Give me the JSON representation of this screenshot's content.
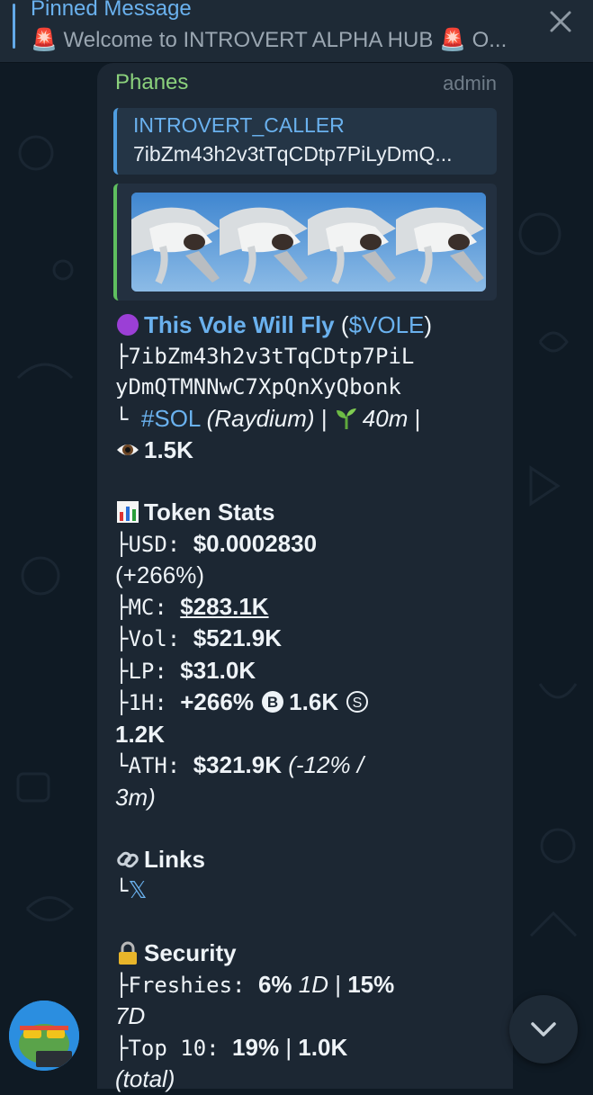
{
  "pinned": {
    "title": "Pinned Message",
    "text": "🚨 Welcome to INTROVERT ALPHA HUB 🚨 O..."
  },
  "message": {
    "sender": "Phanes",
    "role": "admin",
    "reply": {
      "name": "INTROVERT_CALLER",
      "text": "7ibZm43h2v3tTqCDtp7PiLyDmQ..."
    },
    "token_name": "This Vole Will Fly",
    "ticker_open": "(",
    "ticker": "$VOLE",
    "ticker_close": ")",
    "address_prefix": "├",
    "address_line1": "7ibZm43h2v3tTqCDtp7PiL",
    "address_line2": "yDmQTMNNwC7XpQnXyQbonk",
    "chain_prefix": "└ ",
    "chain_tag": "#SOL",
    "chain_dex": "(Raydium)",
    "sep": " | ",
    "age": "40m",
    "sep_end": " |",
    "views": "1.5K",
    "stats_title": "Token Stats",
    "stats": {
      "usd_label": "├USD:   ",
      "usd_value": "$0.0002830",
      "usd_change": "(+266%)",
      "mc_label": "├MC:    ",
      "mc_value": "$283.1K",
      "vol_label": "├Vol:   ",
      "vol_value": "$521.9K",
      "lp_label": "├LP:    ",
      "lp_value": "$31.0K",
      "h1_label": "├1H:    ",
      "h1_change": "+266%",
      "h1_buys": "1.6K",
      "h1_sells": "1.2K",
      "ath_label": "└ATH:   ",
      "ath_value": "$321.9K",
      "ath_change": "(-12% /",
      "ath_time": "3m)"
    },
    "links_title": "Links",
    "links_prefix": "└",
    "links_x": "𝕏",
    "security_title": "Security",
    "security": {
      "freshies_label": "├Freshies: ",
      "freshies_1d": "6%",
      "freshies_1d_unit": "1D",
      "freshies_7d": "15%",
      "freshies_7d_unit": "7D",
      "top10_label": "├Top 10:    ",
      "top10_pct": "19%",
      "top10_amount": "1.0K",
      "top10_note": "(total)"
    }
  },
  "colors": {
    "accent_blue": "#6ab1ee",
    "sender_green": "#8bd17c",
    "bubble": "#1c2733",
    "background": "#0f1a24"
  },
  "icons": {
    "pinned_close": "close-icon",
    "scroll_down": "chevron-down-icon",
    "token": "purple-circle-icon",
    "age": "seedling-icon",
    "views": "eye-icon",
    "stats": "bar-chart-icon",
    "links": "link-icon",
    "security": "lock-icon",
    "buys": "circled-b-icon",
    "sells": "circled-s-icon"
  }
}
